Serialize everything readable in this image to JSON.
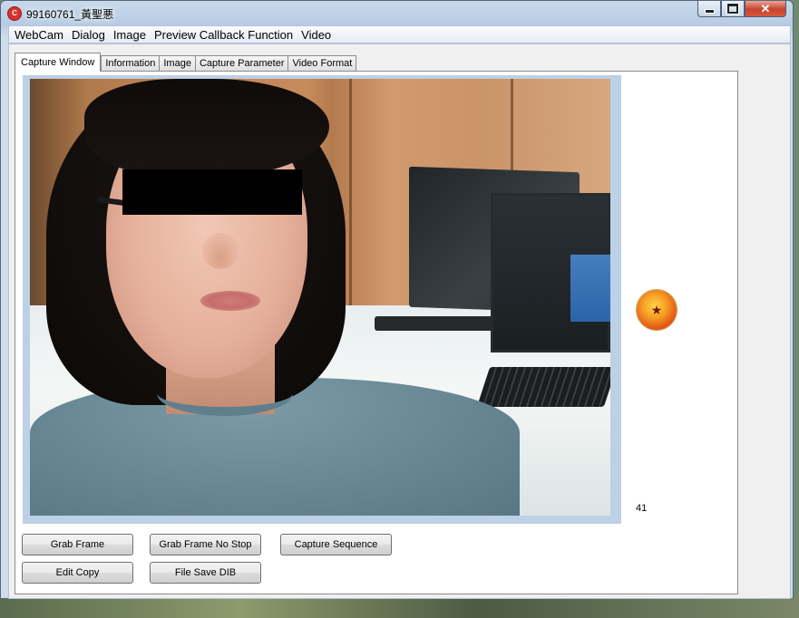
{
  "window": {
    "title": "99160761_黃聖悪",
    "app_icon_glyph": "C",
    "controls": {
      "close_glyph": "✕"
    }
  },
  "menubar": {
    "items": [
      "WebCam",
      "Dialog",
      "Image",
      "Preview Callback Function",
      "Video"
    ]
  },
  "tabs": {
    "items": [
      "Capture Window",
      "Information",
      "Image",
      "Capture Parameter",
      "Video Format"
    ],
    "active": "Capture Window"
  },
  "capture_window": {
    "frame_counter": "41",
    "indicator_icon": "star-ball-icon",
    "indicator_glyph": "★"
  },
  "buttons": {
    "grab_frame": "Grab Frame",
    "grab_frame_no_stop": "Grab Frame No Stop",
    "capture_sequence": "Capture Sequence",
    "edit_copy": "Edit Copy",
    "file_save_dib": "File Save DIB"
  },
  "colors": {
    "window_frame": "#c9d9ea",
    "close_button": "#c7432c",
    "preview_border": "#bcd0e6",
    "indicator": "#f7a224"
  }
}
